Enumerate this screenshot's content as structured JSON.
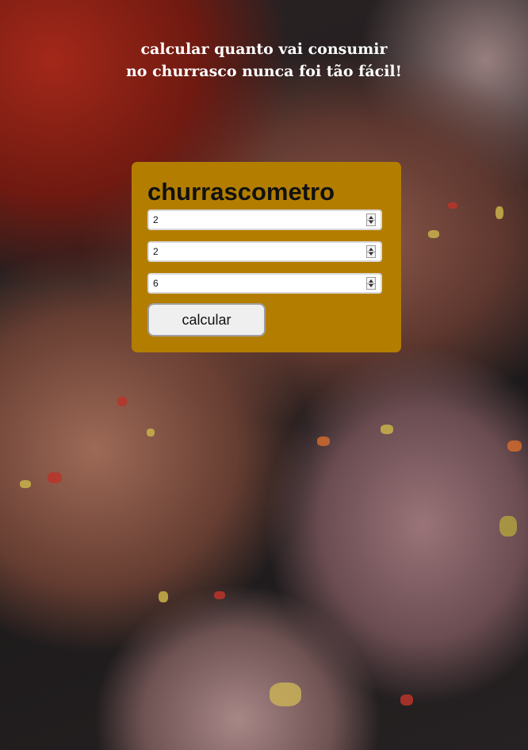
{
  "headline": {
    "line1": "calcular quanto vai consumir",
    "line2": "no churrasco nunca foi tão fácil!"
  },
  "form": {
    "title": "churrascometro",
    "inputs": [
      {
        "value": "2"
      },
      {
        "value": "2"
      },
      {
        "value": "6"
      }
    ],
    "submit_label": "calcular"
  },
  "colors": {
    "card_background": "#b37e00",
    "headline_text": "#ffffff"
  }
}
